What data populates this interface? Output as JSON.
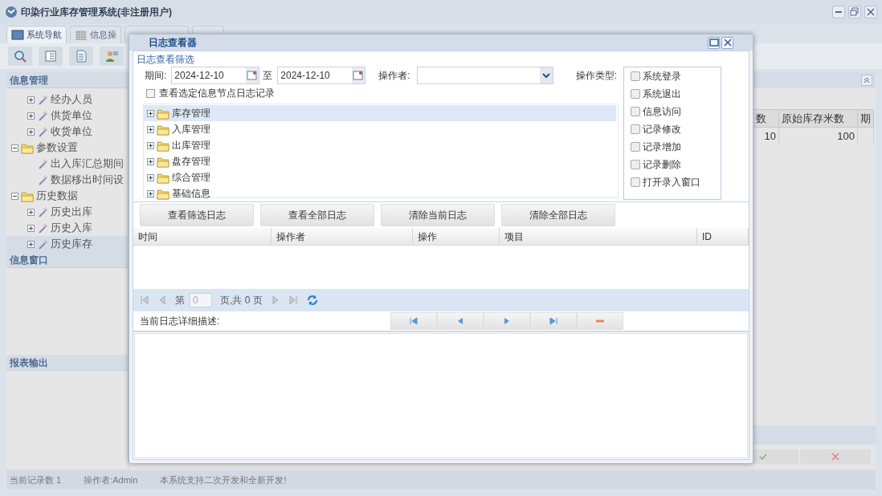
{
  "window": {
    "title": "印染行业库存管理系统(非注册用户)"
  },
  "tabs": [
    {
      "label": "系统导航",
      "selected": true
    },
    {
      "label": "信息操",
      "selected": false
    }
  ],
  "sidebar": {
    "panels": [
      {
        "title": "信息管理",
        "tree": [
          {
            "label": "经办人员",
            "kind": "leaf",
            "expanded": false,
            "selected": false
          },
          {
            "label": "供货单位",
            "kind": "leaf",
            "expanded": false,
            "selected": false
          },
          {
            "label": "收货单位",
            "kind": "leaf",
            "expanded": false,
            "selected": false
          },
          {
            "label": "参数设置",
            "kind": "folder",
            "expanded": true,
            "selected": false,
            "children": [
              {
                "label": "出入库汇总期间",
                "kind": "item",
                "selected": false
              },
              {
                "label": "数据移出时间设",
                "kind": "item",
                "selected": false
              }
            ]
          },
          {
            "label": "历史数据",
            "kind": "folder",
            "expanded": true,
            "selected": false,
            "children": [
              {
                "label": "历史出库",
                "kind": "leaf",
                "expanded": false,
                "selected": false
              },
              {
                "label": "历史入库",
                "kind": "leaf",
                "expanded": false,
                "selected": false
              },
              {
                "label": "历史库存",
                "kind": "leaf",
                "expanded": false,
                "selected": true
              }
            ]
          }
        ]
      },
      {
        "title": "信息窗口"
      },
      {
        "title": "报表输出"
      }
    ]
  },
  "table": {
    "columns": [
      "数",
      "原始库存米数",
      "期"
    ],
    "rows": [
      [
        "10",
        "100",
        ""
      ]
    ]
  },
  "status_bar": [
    "当前记录数 1",
    "操作者:Admin",
    "本系统支持二次开发和全新开发!"
  ],
  "dialog": {
    "title": "日志查看器",
    "filter": {
      "legend": "日志查看筛选",
      "period_label": "期间:",
      "date_from": "2024-12-10",
      "to_label": "至",
      "date_to": "2024-12-10",
      "operator_label": "操作者:",
      "operation_type_label": "操作类型:",
      "node_only": {
        "label": "查看选定信息节点日志记录",
        "checked": false
      },
      "operation_types": [
        {
          "label": "系统登录",
          "checked": false
        },
        {
          "label": "系统退出",
          "checked": false
        },
        {
          "label": "信息访问",
          "checked": false
        },
        {
          "label": "记录修改",
          "checked": false
        },
        {
          "label": "记录增加",
          "checked": false
        },
        {
          "label": "记录删除",
          "checked": false
        },
        {
          "label": "打开录入窗口",
          "checked": false
        }
      ],
      "nodes": [
        {
          "label": "库存管理",
          "selected": true
        },
        {
          "label": "入库管理",
          "selected": false
        },
        {
          "label": "出库管理",
          "selected": false
        },
        {
          "label": "盘存管理",
          "selected": false
        },
        {
          "label": "综合管理",
          "selected": false
        },
        {
          "label": "基础信息",
          "selected": false
        }
      ]
    },
    "buttons": [
      "查看筛选日志",
      "查看全部日志",
      "清除当前日志",
      "清除全部日志"
    ],
    "grid": {
      "columns": [
        "时间",
        "操作者",
        "操作",
        "项目",
        "ID"
      ]
    },
    "pager": {
      "page_label": "第",
      "page": "0",
      "total": "页,共 0 页"
    },
    "detail_label": "当前日志详细描述:"
  }
}
